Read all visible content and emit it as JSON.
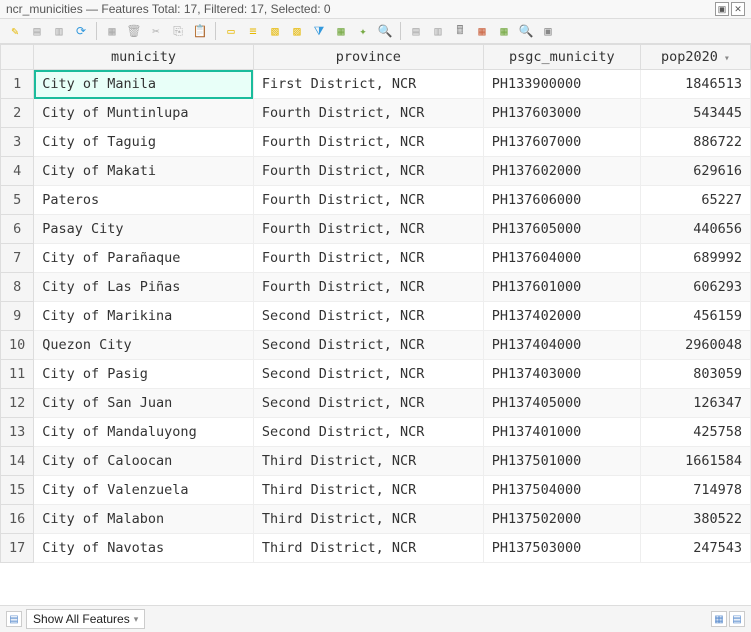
{
  "title": "ncr_municities — Features Total: 17, Filtered: 17, Selected: 0",
  "columns": [
    "municity",
    "province",
    "psgc_municity",
    "pop2020"
  ],
  "sorted_col": 3,
  "rows": [
    {
      "municity": "City of Manila",
      "province": "First District, NCR",
      "psgc": "PH133900000",
      "pop": 1846513
    },
    {
      "municity": "City of Muntinlupa",
      "province": "Fourth District, NCR",
      "psgc": "PH137603000",
      "pop": 543445
    },
    {
      "municity": "City of Taguig",
      "province": "Fourth District, NCR",
      "psgc": "PH137607000",
      "pop": 886722
    },
    {
      "municity": "City of Makati",
      "province": "Fourth District, NCR",
      "psgc": "PH137602000",
      "pop": 629616
    },
    {
      "municity": "Pateros",
      "province": "Fourth District, NCR",
      "psgc": "PH137606000",
      "pop": 65227
    },
    {
      "municity": "Pasay City",
      "province": "Fourth District, NCR",
      "psgc": "PH137605000",
      "pop": 440656
    },
    {
      "municity": "City of Parañaque",
      "province": "Fourth District, NCR",
      "psgc": "PH137604000",
      "pop": 689992
    },
    {
      "municity": "City of Las Piñas",
      "province": "Fourth District, NCR",
      "psgc": "PH137601000",
      "pop": 606293
    },
    {
      "municity": "City of Marikina",
      "province": "Second District, NCR",
      "psgc": "PH137402000",
      "pop": 456159
    },
    {
      "municity": "Quezon City",
      "province": "Second District, NCR",
      "psgc": "PH137404000",
      "pop": 2960048
    },
    {
      "municity": "City of Pasig",
      "province": "Second District, NCR",
      "psgc": "PH137403000",
      "pop": 803059
    },
    {
      "municity": "City of San Juan",
      "province": "Second District, NCR",
      "psgc": "PH137405000",
      "pop": 126347
    },
    {
      "municity": "City of Mandaluyong",
      "province": "Second District, NCR",
      "psgc": "PH137401000",
      "pop": 425758
    },
    {
      "municity": "City of Caloocan",
      "province": "Third District, NCR",
      "psgc": "PH137501000",
      "pop": 1661584
    },
    {
      "municity": "City of Valenzuela",
      "province": "Third District, NCR",
      "psgc": "PH137504000",
      "pop": 714978
    },
    {
      "municity": "City of Malabon",
      "province": "Third District, NCR",
      "psgc": "PH137502000",
      "pop": 380522
    },
    {
      "municity": "City of Navotas",
      "province": "Third District, NCR",
      "psgc": "PH137503000",
      "pop": 247543
    }
  ],
  "status_filter": "Show All Features",
  "toolbar_icons": [
    "pencil",
    "save",
    "save-as",
    "reload",
    "sep",
    "add",
    "delete",
    "cut",
    "copy",
    "paste",
    "sep",
    "new-field",
    "select-all",
    "invert",
    "deselect",
    "filter",
    "form",
    "conditional",
    "zoom",
    "sep",
    "field-calc",
    "highlight",
    "panel",
    "action",
    "layout",
    "dock",
    "close-panel"
  ],
  "chart_data": {
    "type": "table",
    "title": "ncr_municities attribute table",
    "columns": [
      "municity",
      "province",
      "psgc_municity",
      "pop2020"
    ],
    "data": [
      [
        "City of Manila",
        "First District, NCR",
        "PH133900000",
        1846513
      ],
      [
        "City of Muntinlupa",
        "Fourth District, NCR",
        "PH137603000",
        543445
      ],
      [
        "City of Taguig",
        "Fourth District, NCR",
        "PH137607000",
        886722
      ],
      [
        "City of Makati",
        "Fourth District, NCR",
        "PH137602000",
        629616
      ],
      [
        "Pateros",
        "Fourth District, NCR",
        "PH137606000",
        65227
      ],
      [
        "Pasay City",
        "Fourth District, NCR",
        "PH137605000",
        440656
      ],
      [
        "City of Parañaque",
        "Fourth District, NCR",
        "PH137604000",
        689992
      ],
      [
        "City of Las Piñas",
        "Fourth District, NCR",
        "PH137601000",
        606293
      ],
      [
        "City of Marikina",
        "Second District, NCR",
        "PH137402000",
        456159
      ],
      [
        "Quezon City",
        "Second District, NCR",
        "PH137404000",
        2960048
      ],
      [
        "City of Pasig",
        "Second District, NCR",
        "PH137403000",
        803059
      ],
      [
        "City of San Juan",
        "Second District, NCR",
        "PH137405000",
        126347
      ],
      [
        "City of Mandaluyong",
        "Second District, NCR",
        "PH137401000",
        425758
      ],
      [
        "City of Caloocan",
        "Third District, NCR",
        "PH137501000",
        1661584
      ],
      [
        "City of Valenzuela",
        "Third District, NCR",
        "PH137504000",
        714978
      ],
      [
        "City of Malabon",
        "Third District, NCR",
        "PH137502000",
        380522
      ],
      [
        "City of Navotas",
        "Third District, NCR",
        "PH137503000",
        247543
      ]
    ]
  }
}
